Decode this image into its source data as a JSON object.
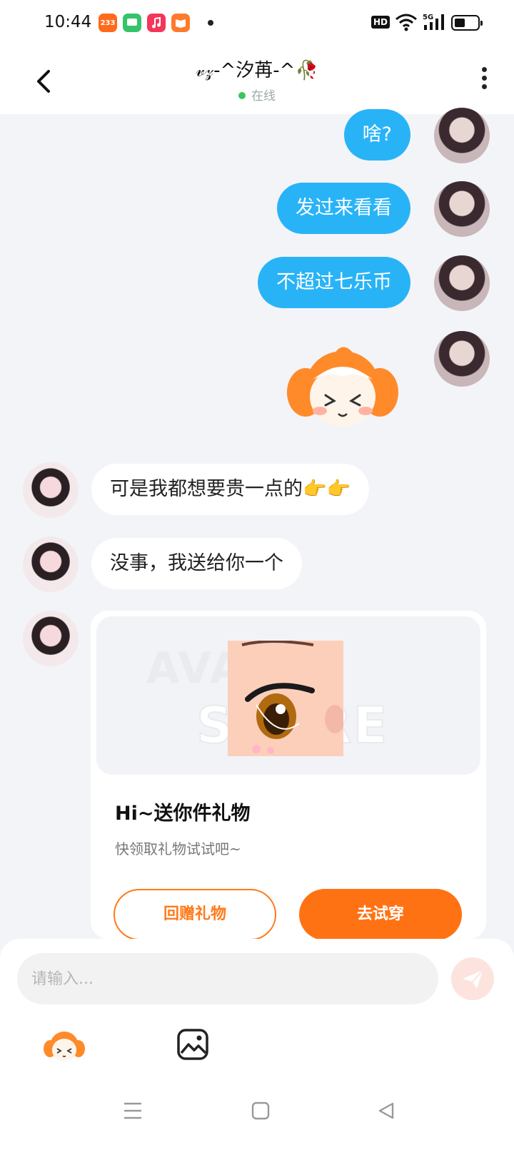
{
  "status_bar": {
    "time": "10:44",
    "app_icons": [
      {
        "name": "233-app-icon",
        "label": "233",
        "color": "#ff6a1a"
      },
      {
        "name": "chat-app-icon",
        "label": "",
        "color": "#35c46a"
      },
      {
        "name": "music-app-icon",
        "label": "",
        "color": "#f4365a"
      },
      {
        "name": "reader-app-icon",
        "label": "",
        "color": "#ff7a2d"
      }
    ],
    "hd_label": "HD",
    "network_label": "5G",
    "battery_level": 0.45
  },
  "header": {
    "title": "𝓋𝓏-^汐苒-^🥀",
    "status": "在线",
    "status_color": "#3bc55c",
    "back_icon": "chevron-left-icon",
    "more_icon": "more-vertical-icon"
  },
  "messages": {
    "outgoing": [
      {
        "text": "啥?"
      },
      {
        "text": "发过来看看"
      },
      {
        "text": "不超过七乐币"
      },
      {
        "sticker": "orange-mascot-sticker"
      }
    ],
    "incoming": [
      {
        "text": "可是我都想要贵一点的👉👉"
      },
      {
        "text": "没事，我送给你一个"
      }
    ],
    "accent_color": "#29b3f7"
  },
  "gift_card": {
    "watermark_line1": "AVATAR",
    "watermark_line2": "STORE",
    "title": "Hi~送你件礼物",
    "subtitle": "快领取礼物试试吧~",
    "return_button": "回赠礼物",
    "try_button": "去试穿",
    "button_color": "#ff7213"
  },
  "input_bar": {
    "placeholder": "请输入...",
    "send_icon": "send-icon",
    "emoji_icon": "mascot-emoji-icon",
    "image_icon": "image-icon"
  },
  "nav_bar": {
    "menu_icon": "menu-icon",
    "home_icon": "home-square-icon",
    "back_icon": "back-triangle-icon"
  }
}
